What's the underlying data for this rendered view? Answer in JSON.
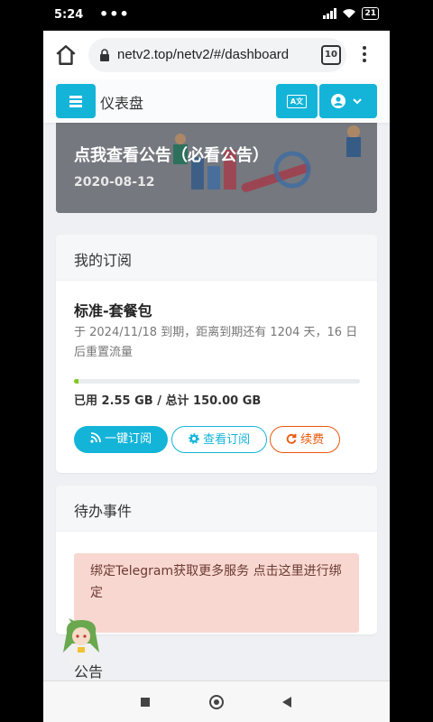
{
  "status_bar": {
    "time": "5:24",
    "indicators": "•••",
    "battery": "21"
  },
  "browser": {
    "url": "netv2.top/netv2/#/dashboard",
    "tab_count": "10"
  },
  "header": {
    "title": "仪表盘"
  },
  "banner": {
    "title": "点我查看公告（必看公告）",
    "date": "2020-08-12"
  },
  "subscription": {
    "heading": "我的订阅",
    "plan_name": "标准-套餐包",
    "description": "于 2024/11/18 到期，距离到期还有 1204 天，16 日后重置流量",
    "usage": "已用 2.55 GB / 总计 150.00 GB",
    "usage_fraction": 0.017,
    "buttons": {
      "subscribe": "一键订阅",
      "view": "查看订阅",
      "renew": "续费"
    }
  },
  "todo": {
    "heading": "待办事件",
    "alert": "绑定Telegram获取更多服务 点击这里进行绑定"
  },
  "notice": {
    "heading": "公告"
  },
  "colors": {
    "primary": "#14b4d9",
    "danger": "#e8590c",
    "progress": "#82c91e",
    "alert_bg": "#f8d7d0"
  }
}
